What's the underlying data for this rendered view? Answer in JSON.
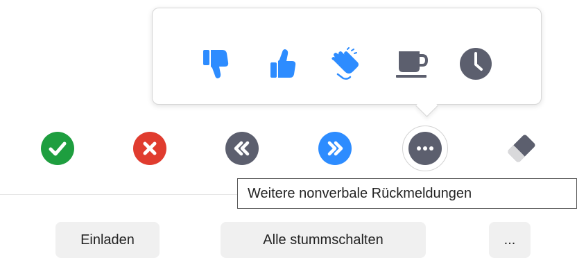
{
  "popup": {
    "reactions": [
      {
        "icon": "thumbs-down-icon",
        "label": ""
      },
      {
        "icon": "thumbs-up-icon",
        "label": ""
      },
      {
        "icon": "clapping-hands-icon",
        "label": ""
      },
      {
        "icon": "coffee-cup-icon",
        "label": ""
      },
      {
        "icon": "clock-icon",
        "label": ""
      }
    ]
  },
  "feedback_row": [
    {
      "icon": "check-circle-icon",
      "color": "#1e9e3f"
    },
    {
      "icon": "x-circle-icon",
      "color": "#e03c2f"
    },
    {
      "icon": "slower-icon",
      "color": "#5c5f6e"
    },
    {
      "icon": "faster-icon",
      "color": "#2d8cff"
    },
    {
      "icon": "more-dots-icon",
      "color": "#5c5f6e"
    },
    {
      "icon": "eraser-icon",
      "color": "#5c5f6e"
    }
  ],
  "tooltip": {
    "text": "Weitere nonverbale Rückmeldungen"
  },
  "buttons": {
    "invite": "Einladen",
    "mute_all": "Alle stummschalten",
    "more": "..."
  },
  "colors": {
    "accent_blue": "#2d8cff",
    "grey": "#5c5f6e",
    "green": "#1e9e3f",
    "red": "#e03c2f",
    "button_bg": "#f0f0f0"
  }
}
